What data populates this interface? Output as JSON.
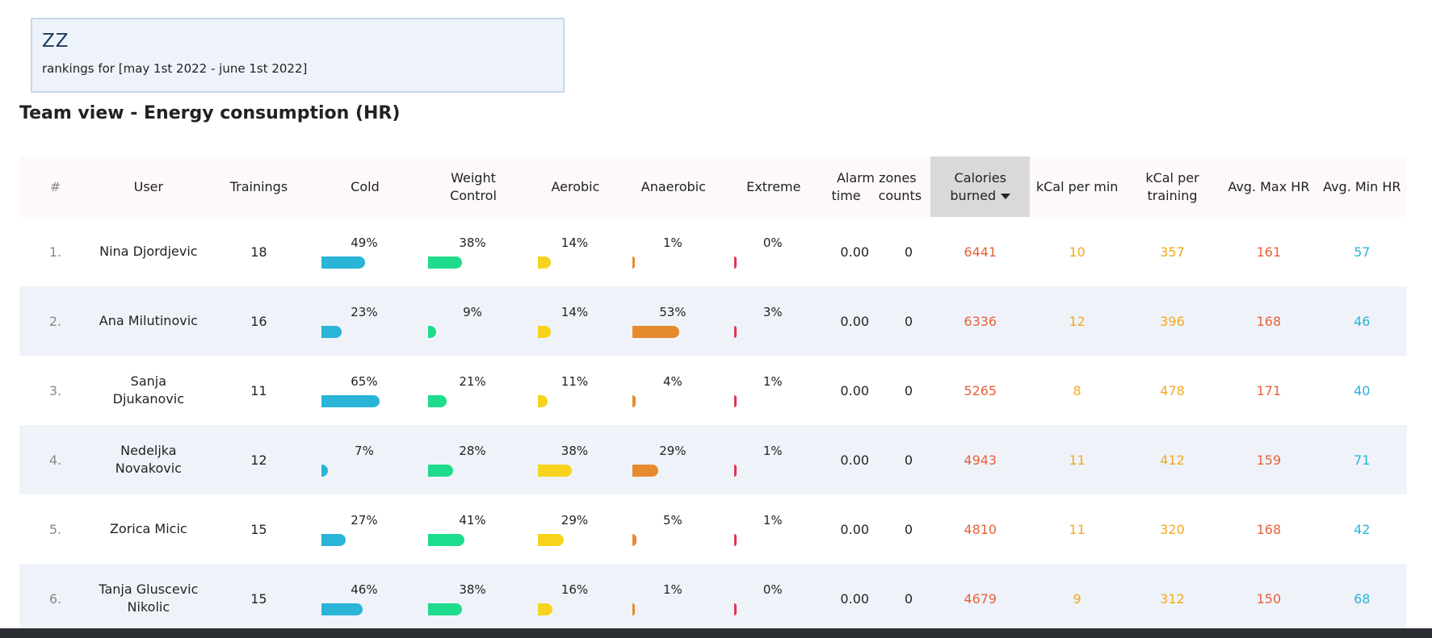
{
  "header": {
    "code": "ZZ",
    "range": "rankings for [may 1st 2022 - june 1st 2022]"
  },
  "view_title": "Team view - Energy consumption (HR)",
  "columns": {
    "rank": "#",
    "user": "User",
    "trainings": "Trainings",
    "cold": "Cold",
    "weight_control": "Weight Control",
    "aerobic": "Aerobic",
    "anaerobic": "Anaerobic",
    "extreme": "Extreme",
    "alarm_zones": "Alarm zones",
    "alarm_time": "time",
    "alarm_counts": "counts",
    "calories_burned": "Calories burned",
    "kcal_per_min": "kCal per min",
    "kcal_per_training": "kCal per training",
    "avg_max_hr": "Avg. Max HR",
    "avg_min_hr": "Avg. Min HR"
  },
  "rows": [
    {
      "rank": "1.",
      "user": "Nina Djordjevic",
      "trainings": "18",
      "cold": "49%",
      "cold_v": 49,
      "weight": "38%",
      "weight_v": 38,
      "aerobic": "14%",
      "aerobic_v": 14,
      "anaerobic": "1%",
      "anaerobic_v": 1,
      "extreme": "0%",
      "extreme_v": 0,
      "alarm_time": "0.00",
      "alarm_counts": "0",
      "calories": "6441",
      "kcal_min": "10",
      "kcal_training": "357",
      "max_hr": "161",
      "min_hr": "57"
    },
    {
      "rank": "2.",
      "user": "Ana Milutinovic",
      "trainings": "16",
      "cold": "23%",
      "cold_v": 23,
      "weight": "9%",
      "weight_v": 9,
      "aerobic": "14%",
      "aerobic_v": 14,
      "anaerobic": "53%",
      "anaerobic_v": 53,
      "extreme": "3%",
      "extreme_v": 3,
      "alarm_time": "0.00",
      "alarm_counts": "0",
      "calories": "6336",
      "kcal_min": "12",
      "kcal_training": "396",
      "max_hr": "168",
      "min_hr": "46"
    },
    {
      "rank": "3.",
      "user": "Sanja Djukanovic",
      "trainings": "11",
      "cold": "65%",
      "cold_v": 65,
      "weight": "21%",
      "weight_v": 21,
      "aerobic": "11%",
      "aerobic_v": 11,
      "anaerobic": "4%",
      "anaerobic_v": 4,
      "extreme": "1%",
      "extreme_v": 1,
      "alarm_time": "0.00",
      "alarm_counts": "0",
      "calories": "5265",
      "kcal_min": "8",
      "kcal_training": "478",
      "max_hr": "171",
      "min_hr": "40"
    },
    {
      "rank": "4.",
      "user": "Nedeljka Novakovic",
      "trainings": "12",
      "cold": "7%",
      "cold_v": 7,
      "weight": "28%",
      "weight_v": 28,
      "aerobic": "38%",
      "aerobic_v": 38,
      "anaerobic": "29%",
      "anaerobic_v": 29,
      "extreme": "1%",
      "extreme_v": 1,
      "alarm_time": "0.00",
      "alarm_counts": "0",
      "calories": "4943",
      "kcal_min": "11",
      "kcal_training": "412",
      "max_hr": "159",
      "min_hr": "71"
    },
    {
      "rank": "5.",
      "user": "Zorica Micic",
      "trainings": "15",
      "cold": "27%",
      "cold_v": 27,
      "weight": "41%",
      "weight_v": 41,
      "aerobic": "29%",
      "aerobic_v": 29,
      "anaerobic": "5%",
      "anaerobic_v": 5,
      "extreme": "1%",
      "extreme_v": 1,
      "alarm_time": "0.00",
      "alarm_counts": "0",
      "calories": "4810",
      "kcal_min": "11",
      "kcal_training": "320",
      "max_hr": "168",
      "min_hr": "42"
    },
    {
      "rank": "6.",
      "user": "Tanja Gluscevic Nikolic",
      "trainings": "15",
      "cold": "46%",
      "cold_v": 46,
      "weight": "38%",
      "weight_v": 38,
      "aerobic": "16%",
      "aerobic_v": 16,
      "anaerobic": "1%",
      "anaerobic_v": 1,
      "extreme": "0%",
      "extreme_v": 0,
      "alarm_time": "0.00",
      "alarm_counts": "0",
      "calories": "4679",
      "kcal_min": "9",
      "kcal_training": "312",
      "max_hr": "150",
      "min_hr": "68"
    }
  ],
  "colors": {
    "cold": "#29b4d8",
    "weight": "#1ddc8c",
    "aerobic": "#f7d31d",
    "anaerobic": "#e68a2e",
    "extreme": "#e0334f"
  }
}
